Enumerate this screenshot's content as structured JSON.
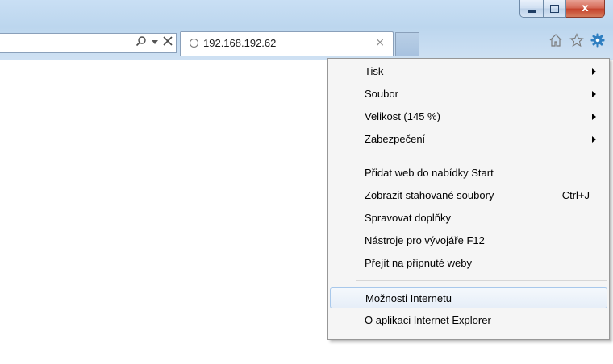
{
  "window": {
    "close_label": "x",
    "min_icon": "minimize-icon",
    "max_icon": "maximize-icon"
  },
  "addressbar": {
    "search_icon": "search-icon",
    "dropdown_icon": "dropdown-arrow-icon",
    "stop_icon": "stop-x-icon"
  },
  "tab": {
    "title": "192.168.192.62",
    "close_label": "×",
    "loading_icon": "loading-icon"
  },
  "toolbar": {
    "home_icon": "home-icon",
    "favorites_icon": "star-icon",
    "tools_icon": "gear-icon"
  },
  "menu": {
    "items": [
      {
        "label": "Tisk",
        "submenu": true
      },
      {
        "label": "Soubor",
        "submenu": true
      },
      {
        "label": "Velikost (145 %)",
        "submenu": true
      },
      {
        "label": "Zabezpečení",
        "submenu": true
      },
      {
        "label": "Přidat web do nabídky Start"
      },
      {
        "label": "Zobrazit stahované soubory",
        "shortcut": "Ctrl+J"
      },
      {
        "label": "Spravovat doplňky"
      },
      {
        "label": "Nástroje pro vývojáře F12"
      },
      {
        "label": "Přejít na připnuté weby"
      },
      {
        "label": "Možnosti Internetu",
        "highlighted": true
      },
      {
        "label": "O aplikaci Internet Explorer"
      }
    ]
  },
  "colors": {
    "frame": "#bcd6ee",
    "close_button": "#c5432c",
    "highlight_border": "#a8c8eb",
    "gear": "#2f7fc1"
  }
}
